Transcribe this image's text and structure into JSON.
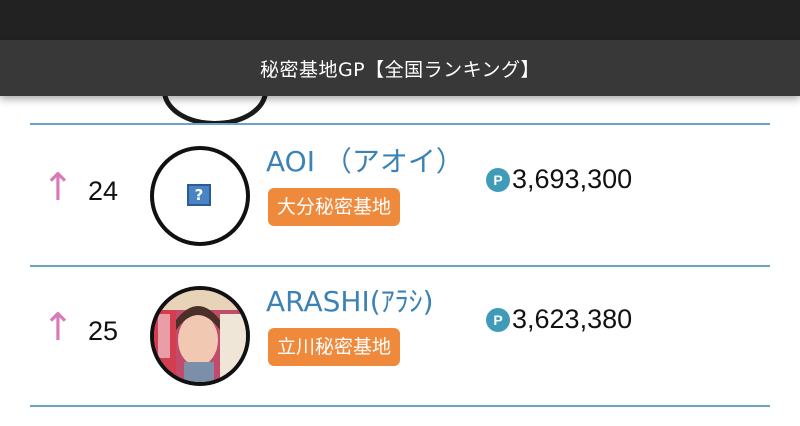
{
  "header": {
    "title": "秘密基地GP【全国ランキング】"
  },
  "rows": [
    {
      "trend": "↑",
      "rank": "24",
      "avatar": "question-mark-placeholder",
      "name": "AOI （アオイ）",
      "base": "大分秘密基地",
      "points_icon": "P",
      "points": "3,693,300"
    },
    {
      "trend": "↑",
      "rank": "25",
      "avatar": "magazine-cover-photo",
      "name": "ARASHI(ｱﾗｼ)",
      "base": "立川秘密基地",
      "points_icon": "P",
      "points": "3,623,380"
    }
  ],
  "colors": {
    "name": "#3c82b6",
    "badge": "#ef8a3c",
    "trend_up": "#d87ab8",
    "points_icon": "#3f9bb7",
    "divider": "#6aa5c4"
  }
}
